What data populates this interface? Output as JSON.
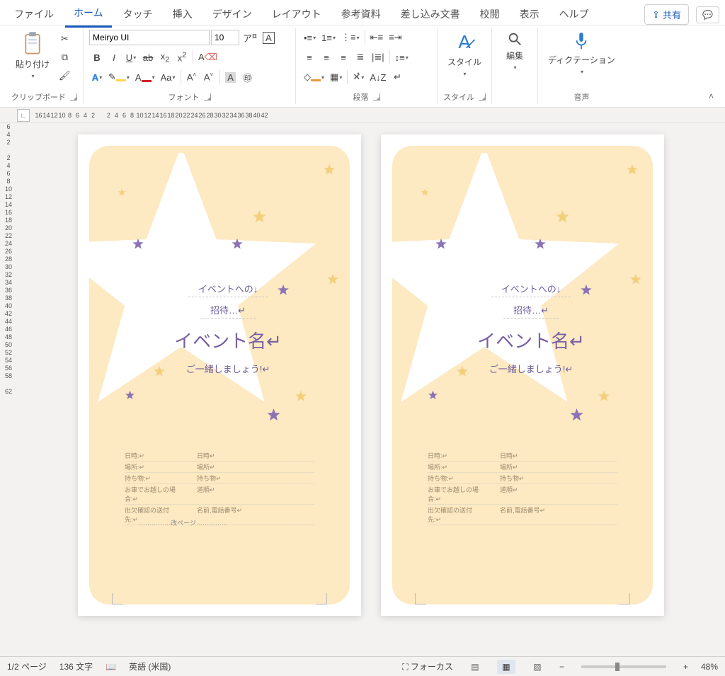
{
  "tabs": {
    "file": "ファイル",
    "home": "ホーム",
    "touch": "タッチ",
    "insert": "挿入",
    "design": "デザイン",
    "layout": "レイアウト",
    "references": "参考資料",
    "mailings": "差し込み文書",
    "review": "校閲",
    "view": "表示",
    "help": "ヘルプ",
    "share": "共有"
  },
  "ribbon": {
    "clipboard": {
      "paste": "貼り付け",
      "label": "クリップボード"
    },
    "font": {
      "name": "Meiryo UI",
      "size": "10",
      "label": "フォント"
    },
    "paragraph": {
      "label": "段落"
    },
    "styles": {
      "btn": "スタイル",
      "label": "スタイル"
    },
    "editing": {
      "btn": "編集"
    },
    "voice": {
      "btn": "ディクテーション",
      "label": "音声"
    }
  },
  "ruler": {
    "h": [
      "16",
      "14",
      "12",
      "10",
      "8",
      "6",
      "4",
      "2",
      "",
      "2",
      "4",
      "6",
      "8",
      "10",
      "12",
      "14",
      "16",
      "18",
      "20",
      "22",
      "24",
      "26",
      "28",
      "30",
      "32",
      "34",
      "36",
      "38",
      "40",
      "42"
    ],
    "v": [
      "6",
      "4",
      "2",
      "",
      "2",
      "4",
      "6",
      "8",
      "10",
      "12",
      "14",
      "16",
      "18",
      "20",
      "22",
      "24",
      "26",
      "28",
      "30",
      "32",
      "34",
      "36",
      "38",
      "40",
      "42",
      "44",
      "46",
      "48",
      "50",
      "52",
      "54",
      "56",
      "58",
      "",
      "62"
    ]
  },
  "flyer": {
    "sub1": "イベントへの↓",
    "sub2": "招待…↵",
    "title": "イベント名↵",
    "tag": "ご一緒しましょう!↵",
    "rows": [
      {
        "l": "日時:↵",
        "r": "日時↵"
      },
      {
        "l": "場所:↵",
        "r": "場所↵"
      },
      {
        "l": "持ち物:↵",
        "r": "持ち物↵"
      },
      {
        "l": "お車でお越しの場合:↵",
        "r": "道順↵"
      },
      {
        "l": "出欠確認の送付先:↵",
        "r": "名前,電話番号↵"
      }
    ],
    "pagebreak": "……………改ページ……………"
  },
  "status": {
    "page": "1/2 ページ",
    "words": "136 文字",
    "lang": "英語 (米国)",
    "focus": "フォーカス",
    "zoom": "48%"
  }
}
